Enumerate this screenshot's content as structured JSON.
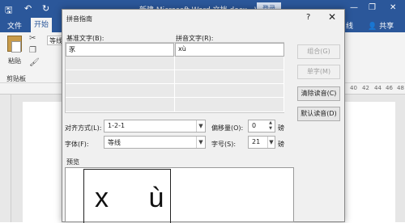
{
  "word": {
    "title": "新建 Microsoft Word 文档.docx  -  Word",
    "login": "登录",
    "tabs": [
      "文件",
      "开始"
    ],
    "active_tab": "开始",
    "right_tabs": [
      "线"
    ],
    "share": "共享",
    "ribbon": {
      "paste": "粘贴",
      "clipboard": "剪贴板",
      "font_box": "等线"
    },
    "ruler_numbers": [
      "40",
      "42",
      "44",
      "46",
      "48"
    ],
    "window_controls": {
      "minimize": "—",
      "restore": "❐",
      "close": "✕"
    }
  },
  "dialog": {
    "title": "拼音指南",
    "help": "?",
    "close": "✕",
    "base_text_label": "基准文字(B):",
    "ruby_text_label": "拼音文字(R):",
    "rows": [
      {
        "base": "豕",
        "ruby": "xù"
      },
      {
        "base": "",
        "ruby": ""
      },
      {
        "base": "",
        "ruby": ""
      },
      {
        "base": "",
        "ruby": ""
      },
      {
        "base": "",
        "ruby": ""
      }
    ],
    "buttons": {
      "combine": "组合(G)",
      "single": "单字(M)",
      "clear": "清除读音(C)",
      "default": "默认读音(D)"
    },
    "alignment_label": "对齐方式(L):",
    "alignment_value": "1-2-1",
    "offset_label": "偏移量(O):",
    "offset_value": "0",
    "offset_unit": "磅",
    "font_label": "字体(F):",
    "font_value": "等线",
    "size_label": "字号(S):",
    "size_value": "21",
    "size_unit": "磅",
    "preview_label": "预览",
    "preview_text": "x  ù"
  }
}
